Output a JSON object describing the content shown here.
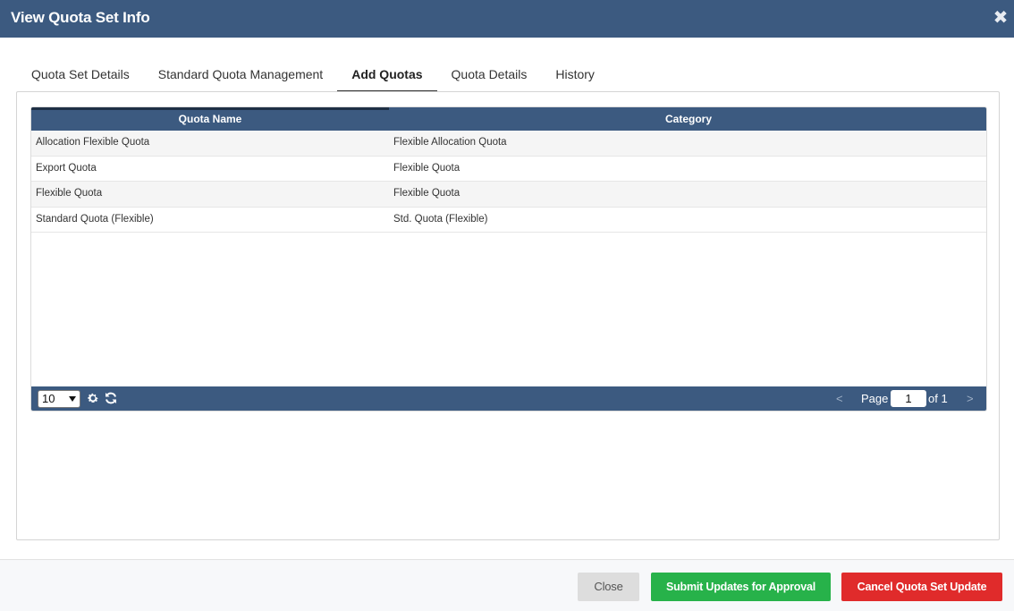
{
  "dialog": {
    "title": "View Quota Set Info",
    "close_icon": "close-x-icon"
  },
  "tabs": [
    {
      "label": "Quota Set Details",
      "active": false
    },
    {
      "label": "Standard Quota Management",
      "active": false
    },
    {
      "label": "Add Quotas",
      "active": true
    },
    {
      "label": "Quota Details",
      "active": false
    },
    {
      "label": "History",
      "active": false
    }
  ],
  "grid": {
    "columns": [
      "Quota Name",
      "Category"
    ],
    "rows": [
      [
        "Allocation Flexible Quota",
        "Flexible Allocation Quota"
      ],
      [
        "Export Quota",
        "Flexible Quota"
      ],
      [
        "Flexible Quota",
        "Flexible Quota"
      ],
      [
        "Standard Quota (Flexible)",
        "Std. Quota (Flexible)"
      ]
    ]
  },
  "pager": {
    "page_size": "10",
    "page_label": "Page",
    "current_page": "1",
    "of_label": "of 1",
    "prev": "<",
    "next": ">",
    "icons": [
      "gear-icon",
      "refresh-icon"
    ]
  },
  "footer": {
    "close_label": "Close",
    "submit_label": "Submit Updates for Approval",
    "cancel_label": "Cancel Quota Set Update"
  },
  "colors": {
    "header": "#3c5a80",
    "submit": "#27b24a",
    "cancel": "#e02b2b"
  }
}
